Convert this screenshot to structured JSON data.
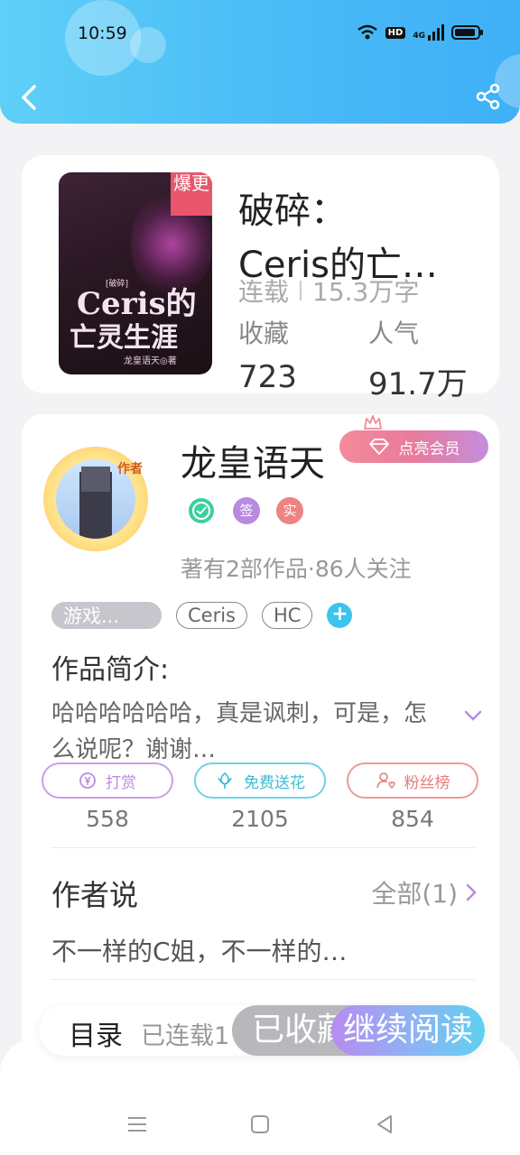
{
  "status_bar": {
    "time": "10:59",
    "network": "HD",
    "signal": "4G"
  },
  "book": {
    "cover": {
      "ribbon": "爆更",
      "small_label": "[破碎]",
      "title_line1": "Ceris的",
      "title_line2": "亡灵生涯",
      "author": "龙皇语天◎著"
    },
    "title_line1": "破碎：",
    "title_line2": "Ceris的亡…",
    "status": "连载",
    "word_count": "15.3万字",
    "favorites_label": "收藏",
    "favorites_value": "723",
    "popularity_label": "人气",
    "popularity_value": "91.7万"
  },
  "author": {
    "avatar_tag": "作者",
    "name": "龙皇语天",
    "vip_button": "点亮会员",
    "badges": [
      "签",
      "实"
    ],
    "works_info": "著有2部作品·86人关注",
    "tags": [
      "游戏...",
      "Ceris",
      "HC"
    ],
    "add_tag": "+"
  },
  "intro": {
    "title": "作品简介:",
    "text": "哈哈哈哈哈哈，真是讽刺，可是，怎么说呢？谢谢…"
  },
  "actions": [
    {
      "label": "打赏",
      "icon": "yen-coin-icon",
      "count": "558",
      "color": "#c48ddd"
    },
    {
      "label": "免费送花",
      "icon": "flower-icon",
      "count": "2105",
      "color": "#4cc7e0"
    },
    {
      "label": "粉丝榜",
      "icon": "fans-icon",
      "count": "854",
      "color": "#ea8a8a"
    }
  ],
  "author_says": {
    "title": "作者说",
    "all_link": "全部(1)",
    "text": "不一样的C姐，不一样的…"
  },
  "bottom_bar": {
    "toc_label": "目录",
    "toc_status": "已连载1",
    "favorite_button": "已收藏",
    "read_button": "继续阅读"
  }
}
